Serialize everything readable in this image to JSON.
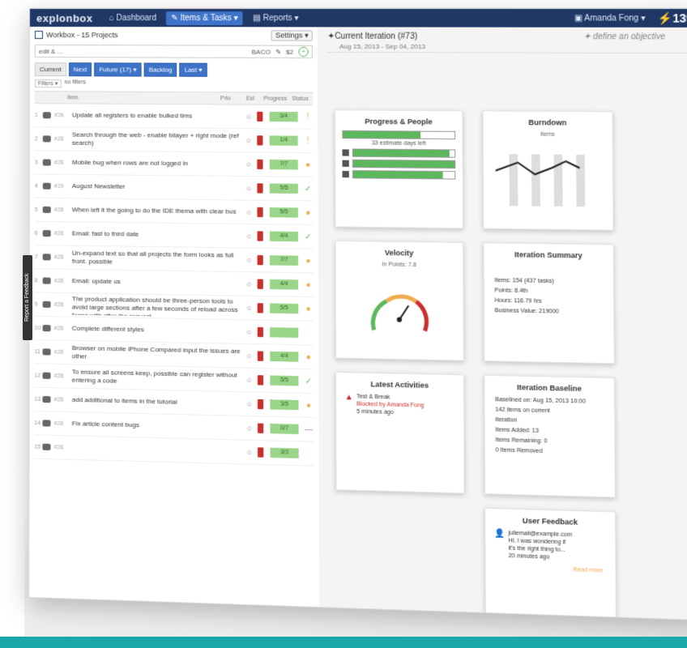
{
  "app": {
    "brand": "explonbox"
  },
  "topnav": {
    "items": [
      {
        "label": "Dashboard",
        "active": false
      },
      {
        "label": "Items & Tasks ▾",
        "active": true
      },
      {
        "label": "Reports ▾",
        "active": false
      }
    ],
    "user": "Amanda Fong ▾",
    "points": "⚡139"
  },
  "workbox": {
    "title": "Workbox - 15 Projects",
    "settings": "Settings ▾",
    "input_value": "edit & ...",
    "input_meta": "BACO",
    "input_count": "$2"
  },
  "tabs": [
    {
      "label": "Current",
      "blue": false
    },
    {
      "label": "Next",
      "blue": true
    },
    {
      "label": "Future (17) ▾",
      "blue": true
    },
    {
      "label": "Backlog",
      "blue": true
    },
    {
      "label": "Last ▾",
      "blue": true
    }
  ],
  "subrow": {
    "filter": "Filters ▾",
    "text": "no filters"
  },
  "columns": {
    "item": "Item",
    "c1": "Prio",
    "c2": "Est",
    "c3": "Progress",
    "c4": "Status"
  },
  "rows": [
    {
      "num": "1",
      "key": "#28",
      "name": "Update all registers to enable bulked tims",
      "progress": "3/4",
      "status": "!",
      "st": "warn"
    },
    {
      "num": "2",
      "key": "#28",
      "name": "Search through the web - enable bilayer + right mode (ref search)",
      "progress": "1/4",
      "status": "!",
      "st": "warn"
    },
    {
      "num": "3",
      "key": "#28",
      "name": "Mobile bug when rows are not logged in",
      "progress": "7/7",
      "status": "●",
      "st": "dot"
    },
    {
      "num": "4",
      "key": "#19",
      "name": "August Newsletter",
      "progress": "5/5",
      "status": "✓",
      "st": "ok"
    },
    {
      "num": "5",
      "key": "#28",
      "name": "When left it the going to do the IDE thema with clear bus",
      "progress": "5/5",
      "status": "●",
      "st": "dot"
    },
    {
      "num": "6",
      "key": "#28",
      "name": "Email: fast to third date",
      "progress": "4/4",
      "status": "✓",
      "st": "ok"
    },
    {
      "num": "7",
      "key": "#28",
      "name": "Un-expand text so that all projects the form looks as full front. possible",
      "progress": "7/7",
      "status": "●",
      "st": "dot"
    },
    {
      "num": "8",
      "key": "#28",
      "name": "Email: update us",
      "progress": "4/4",
      "status": "●",
      "st": "dot"
    },
    {
      "num": "9",
      "key": "#28",
      "name": "The product application should be three-person tools to avoid large sections after a few seconds of reload across forms with after the request",
      "progress": "5/5",
      "status": "●",
      "st": "dot"
    },
    {
      "num": "10",
      "key": "#28",
      "name": "Complete different styles",
      "progress": "",
      "status": "",
      "st": "dash"
    },
    {
      "num": "11",
      "key": "#28",
      "name": "Browser on mobile iPhone Compared input the issues are other",
      "progress": "4/4",
      "status": "●",
      "st": "dot"
    },
    {
      "num": "12",
      "key": "#28",
      "name": "To ensure all screens keep, possible can register without entering a code",
      "progress": "5/5",
      "status": "✓",
      "st": "ok"
    },
    {
      "num": "13",
      "key": "#28",
      "name": "add additional to items in the tutorial",
      "progress": "3/5",
      "status": "●",
      "st": "dot"
    },
    {
      "num": "14",
      "key": "#28",
      "name": "Fix article content bugs",
      "progress": "0/7",
      "status": "—",
      "st": "dash"
    },
    {
      "num": "15",
      "key": "#28",
      "name": "",
      "progress": "3/3",
      "status": "",
      "st": "dash"
    }
  ],
  "iteration": {
    "title": "Current Iteration (#73)",
    "objective": "define an objective",
    "dates": "Aug 15, 2013 - Sep 04, 2013"
  },
  "progress_card": {
    "title": "Progress & People",
    "overall": 0.7,
    "label": "33 estimate days left",
    "people": [
      0.95,
      1.0,
      0.88
    ]
  },
  "burndown_card": {
    "title": "Burndown",
    "subtitle": "items"
  },
  "velocity_card": {
    "title": "Velocity",
    "subtitle": "In Points: 7.8"
  },
  "summary_card": {
    "title": "Iteration Summary",
    "lines": [
      "Items: 154 (437 tasks)",
      "Points: 8.4th",
      "Hours: 116.79 hrs",
      "Business Value: 219000"
    ]
  },
  "activities_card": {
    "title": "Latest Activities",
    "lines": [
      "Test & Break",
      "Blocked by Amanda Fong",
      "5 minutes ago"
    ]
  },
  "baseline_card": {
    "title": "Iteration Baseline",
    "lines": [
      "Baselined on: Aug 15, 2013 10:00",
      "142 items on current",
      "Iteration",
      "Items Added: 13",
      "Items Remaining: 0",
      "0 Items Removed"
    ]
  },
  "feedback_card": {
    "title": "User Feedback",
    "lines": [
      "juliemail@example.com",
      "Hi, I was wondering if",
      "it's the right thing to...",
      "20 minutes ago"
    ],
    "readmore": "Read more"
  },
  "side_tab": "Report a Feedback"
}
